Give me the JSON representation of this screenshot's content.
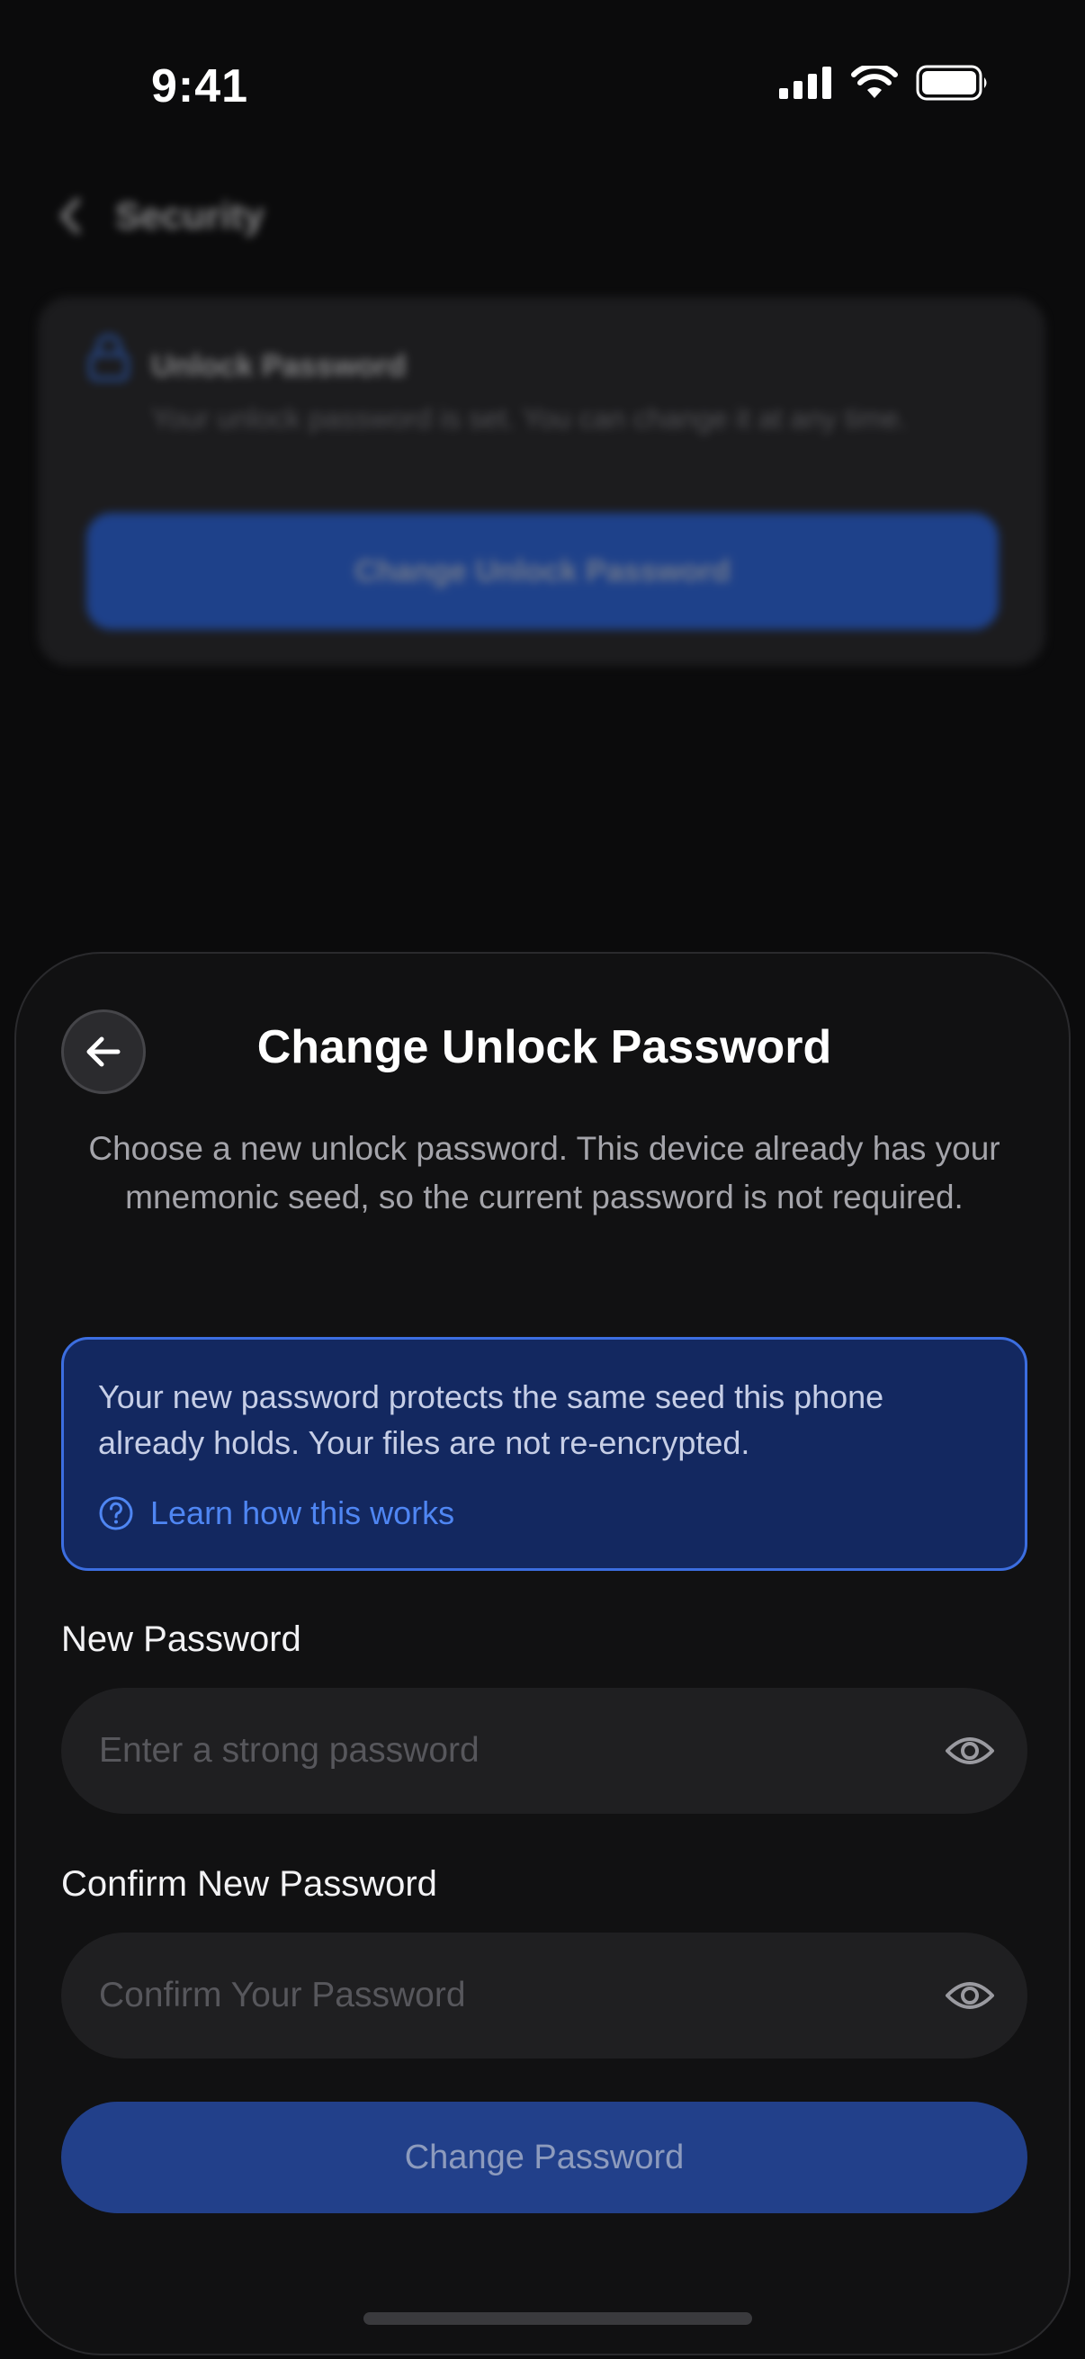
{
  "status_bar": {
    "time": "9:41",
    "icons": [
      "cellular-signal-icon",
      "wifi-icon",
      "battery-icon"
    ]
  },
  "background_screen": {
    "nav_title": "Security",
    "card": {
      "title": "Unlock Password",
      "description": "Your unlock password is set. You can change it at any time.",
      "button_label": "Change Unlock Password"
    }
  },
  "sheet": {
    "title": "Change Unlock Password",
    "subtitle": "Choose a new unlock password. This device already has your mnemonic seed, so the current password is not required.",
    "info": {
      "text": "Your new password protects the same seed this phone already holds. Your files are not re-encrypted.",
      "link_label": "Learn how this works"
    },
    "new_password": {
      "label": "New Password",
      "placeholder": "Enter a strong password",
      "value": ""
    },
    "confirm_password": {
      "label": "Confirm New Password",
      "placeholder": "Confirm Your Password",
      "value": ""
    },
    "submit_label": "Change Password"
  },
  "colors": {
    "accent": "#2f6ef2",
    "info_background": "#132860",
    "info_border": "#3c6ee0",
    "link": "#4f86f3",
    "submit_disabled": "#22408a"
  }
}
